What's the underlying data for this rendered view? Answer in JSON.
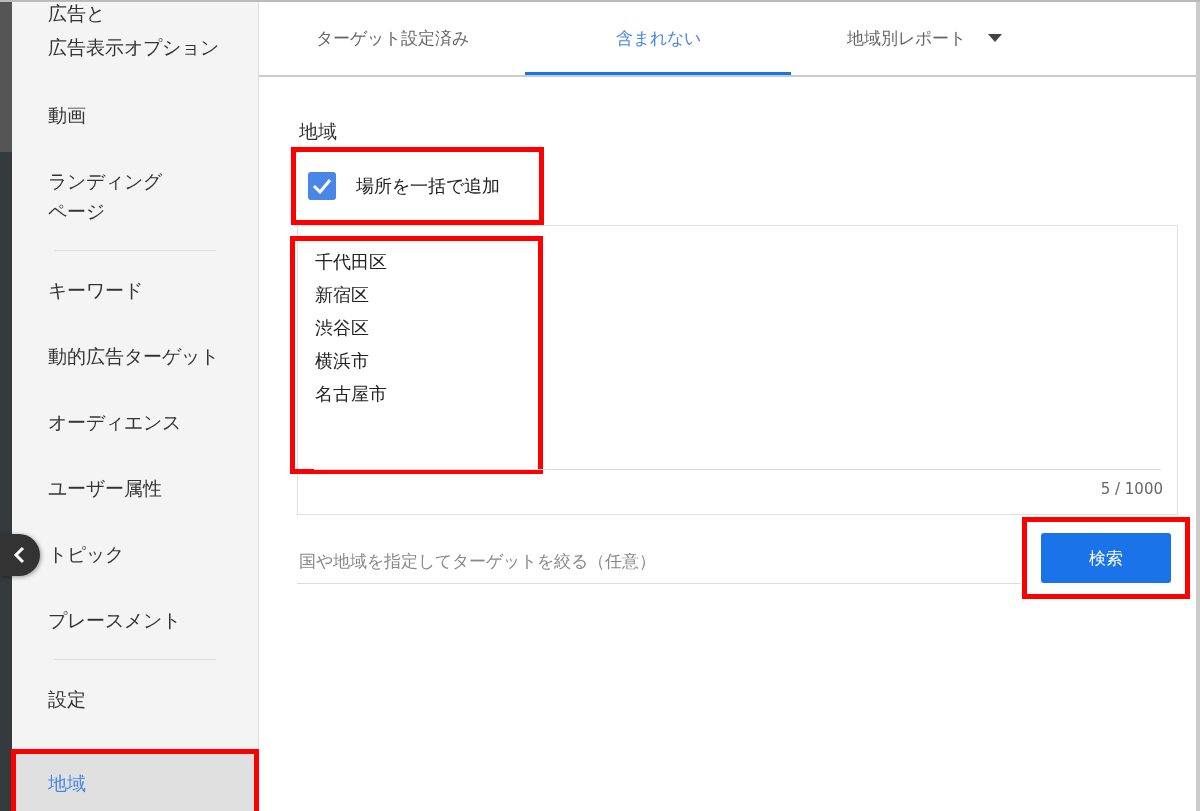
{
  "sidebar": {
    "items": [
      {
        "lines": [
          "広告と",
          "広告表示オプション"
        ],
        "selected": false,
        "highlighted": false
      },
      {
        "label": "動画",
        "selected": false,
        "highlighted": false
      },
      {
        "lines": [
          "ランディング",
          "ページ"
        ],
        "selected": false,
        "highlighted": false,
        "divider_after": true
      },
      {
        "label": "キーワード",
        "selected": false,
        "highlighted": false
      },
      {
        "label": "動的広告ターゲット",
        "selected": false,
        "highlighted": false
      },
      {
        "label": "オーディエンス",
        "selected": false,
        "highlighted": false
      },
      {
        "label": "ユーザー属性",
        "selected": false,
        "highlighted": false
      },
      {
        "label": "トピック",
        "selected": false,
        "highlighted": false
      },
      {
        "label": "プレースメント",
        "selected": false,
        "highlighted": false,
        "divider_after": true
      },
      {
        "label": "設定",
        "selected": false,
        "highlighted": false
      },
      {
        "label": "地域",
        "selected": true,
        "highlighted": true
      }
    ]
  },
  "tabs": [
    {
      "label": "ターゲット設定済み",
      "selected": false
    },
    {
      "label": "含まれない",
      "selected": true
    },
    {
      "label": "地域別レポート",
      "selected": false,
      "dropdown": true
    }
  ],
  "section_label": "地域",
  "bulk_add": {
    "label": "場所を一括で追加",
    "checked": true,
    "highlighted": true
  },
  "locations": {
    "lines": [
      "千代田区",
      "新宿区",
      "渋谷区",
      "横浜市",
      "名古屋市"
    ],
    "counter": "5 / 1000",
    "highlighted": true
  },
  "filter": {
    "placeholder": "国や地域を指定してターゲットを絞る（任意）"
  },
  "search_button": {
    "label": "検索",
    "highlighted": true
  }
}
